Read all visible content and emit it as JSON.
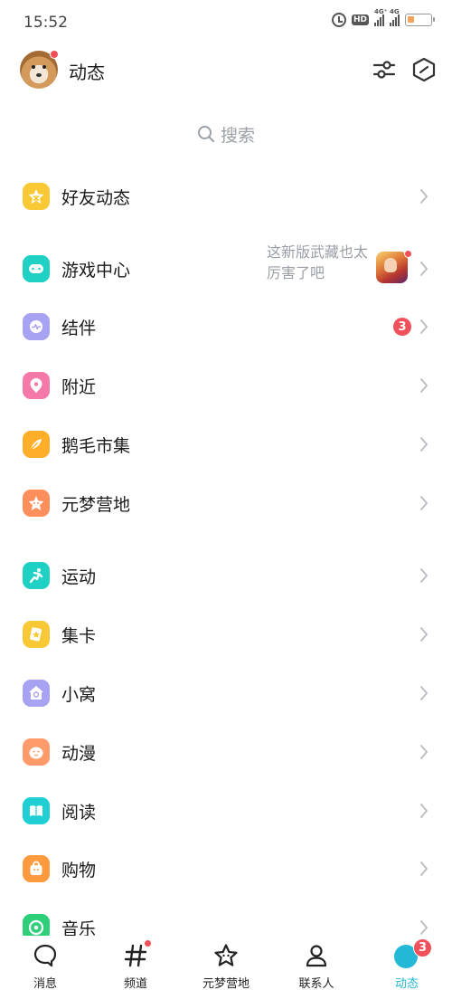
{
  "status_bar": {
    "time": "15:52",
    "hd_label": "HD",
    "signal_1": "4G⁺",
    "signal_2": "4G",
    "battery_level": 0.3
  },
  "header": {
    "title": "动态"
  },
  "search": {
    "placeholder": "搜索"
  },
  "menu": {
    "friends": {
      "label": "好友动态"
    },
    "game_center": {
      "label": "游戏中心",
      "note": "这新版武藏也太厉害了吧"
    },
    "partner": {
      "label": "结伴",
      "badge": "3"
    },
    "nearby": {
      "label": "附近"
    },
    "market": {
      "label": "鹅毛市集"
    },
    "yuanmeng": {
      "label": "元梦营地"
    },
    "sports": {
      "label": "运动"
    },
    "cards": {
      "label": "集卡"
    },
    "nest": {
      "label": "小窝"
    },
    "anime": {
      "label": "动漫"
    },
    "reading": {
      "label": "阅读"
    },
    "shopping": {
      "label": "购物"
    },
    "music": {
      "label": "音乐"
    }
  },
  "bottom_nav": {
    "messages": {
      "label": "消息"
    },
    "channels": {
      "label": "频道"
    },
    "yuanmeng": {
      "label": "元梦营地"
    },
    "contacts": {
      "label": "联系人"
    },
    "moments": {
      "label": "动态",
      "badge": "3"
    }
  },
  "colors": {
    "accent": "#22b8d6",
    "badge_red": "#f0505a",
    "icon_yellow": "#f9c935",
    "icon_teal": "#1fd0c4",
    "icon_purple": "#a8a2f2",
    "icon_pink": "#f478a8",
    "icon_orange": "#ffae2a",
    "icon_peach": "#ff9b6a",
    "icon_green": "#2fcf7a"
  }
}
